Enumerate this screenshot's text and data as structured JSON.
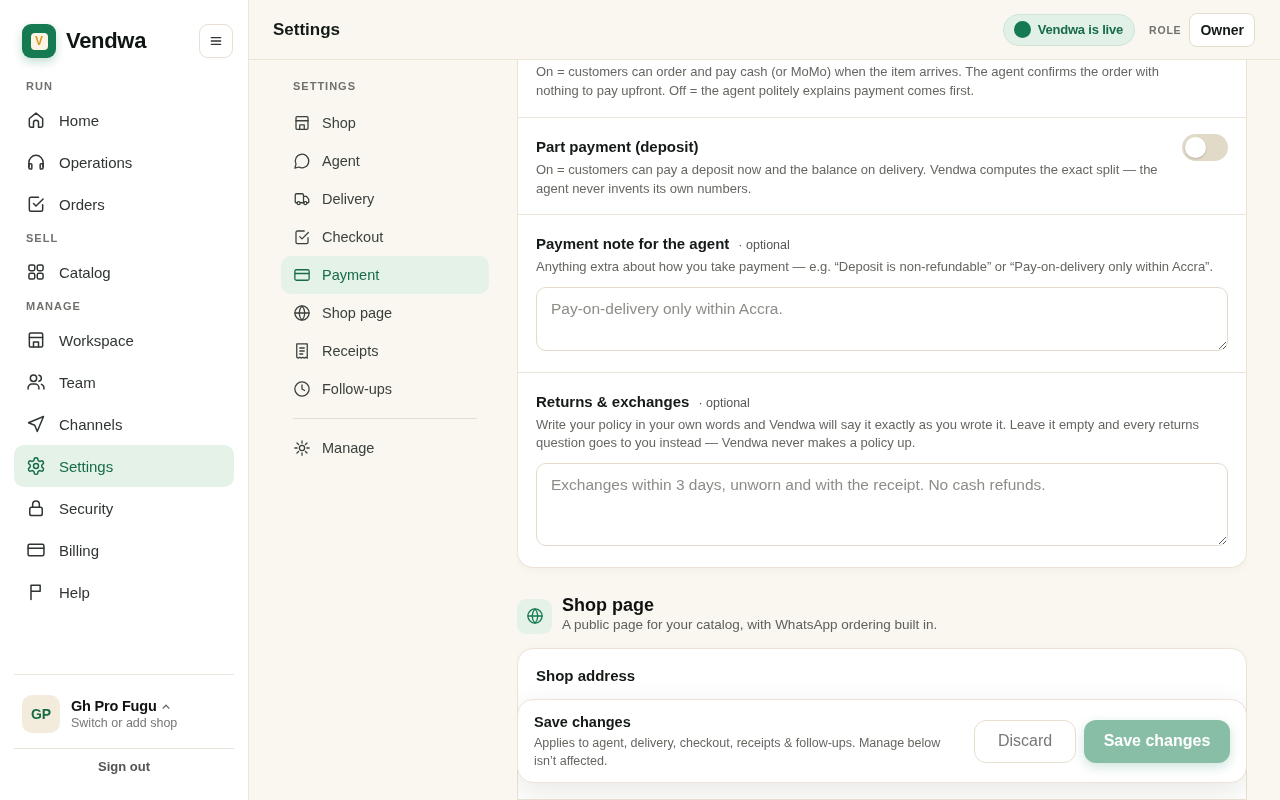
{
  "sidebar": {
    "brand": {
      "mark": "V",
      "name": "Vendwa"
    },
    "sections": [
      {
        "label": "RUN",
        "items": [
          {
            "label": "Home",
            "selected": false
          },
          {
            "label": "Operations",
            "selected": false
          },
          {
            "label": "Orders",
            "selected": false
          }
        ]
      },
      {
        "label": "SELL",
        "items": [
          {
            "label": "Catalog",
            "selected": false
          }
        ]
      },
      {
        "label": "MANAGE",
        "items": [
          {
            "label": "Workspace",
            "selected": false
          },
          {
            "label": "Team",
            "selected": false
          },
          {
            "label": "Channels",
            "selected": false
          },
          {
            "label": "Settings",
            "selected": true
          },
          {
            "label": "Security",
            "selected": false
          },
          {
            "label": "Billing",
            "selected": false
          },
          {
            "label": "Help",
            "selected": false
          }
        ]
      }
    ],
    "account": {
      "initials": "GP",
      "name": "Gh Pro Fugu",
      "subtitle": "Switch or add shop"
    },
    "sign_out": "Sign out"
  },
  "header": {
    "title": "Settings",
    "status": {
      "label": "Vendwa is live",
      "live": true
    },
    "role_label": "ROLE",
    "role": "Owner"
  },
  "settings_nav": {
    "label": "SETTINGS",
    "items": [
      {
        "label": "Shop",
        "selected": false
      },
      {
        "label": "Agent",
        "selected": false
      },
      {
        "label": "Delivery",
        "selected": false
      },
      {
        "label": "Checkout",
        "selected": false
      },
      {
        "label": "Payment",
        "selected": true
      },
      {
        "label": "Shop page",
        "selected": false
      },
      {
        "label": "Receipts",
        "selected": false
      },
      {
        "label": "Follow-ups",
        "selected": false
      }
    ],
    "footer_items": [
      {
        "label": "Manage",
        "selected": false
      }
    ]
  },
  "payment_card": {
    "rows": [
      {
        "kind": "toggle",
        "description": "On = customers can order and pay cash (or MoMo) when the item arrives. The agent confirms the order with nothing to pay upfront. Off = the agent politely explains payment comes first."
      },
      {
        "kind": "toggle",
        "title": "Part payment (deposit)",
        "description": "On = customers can pay a deposit now and the balance on delivery. Vendwa computes the exact split — the agent never invents its own numbers.",
        "on": false
      },
      {
        "kind": "textarea",
        "title": "Payment note for the agent",
        "tag": "· optional",
        "description": "Anything extra about how you take payment — e.g. “Deposit is non-refundable” or “Pay-on-delivery only within Accra”.",
        "placeholder": "Pay-on-delivery only within Accra."
      },
      {
        "kind": "textarea",
        "title": "Returns & exchanges",
        "tag": "· optional",
        "description": "Write your policy in your own words and Vendwa will say it exactly as you wrote it. Leave it empty and every returns question goes to you instead — Vendwa never makes a policy up.",
        "placeholder": "Exchanges within 3 days, unworn and with the receipt. No cash refunds."
      }
    ]
  },
  "shop_page": {
    "title": "Shop page",
    "subtitle": "A public page for your catalog, with WhatsApp ordering built in.",
    "rows": [
      {
        "title": "Shop address"
      }
    ]
  },
  "save_bar": {
    "title": "Save changes",
    "description": "Applies to agent, delivery, checkout, receipts & follow-ups. Manage below isn’t affected.",
    "buttons": [
      {
        "label": "Discard",
        "kind": "secondary",
        "disabled": false
      },
      {
        "label": "Save changes",
        "kind": "primary",
        "disabled": true
      }
    ]
  }
}
